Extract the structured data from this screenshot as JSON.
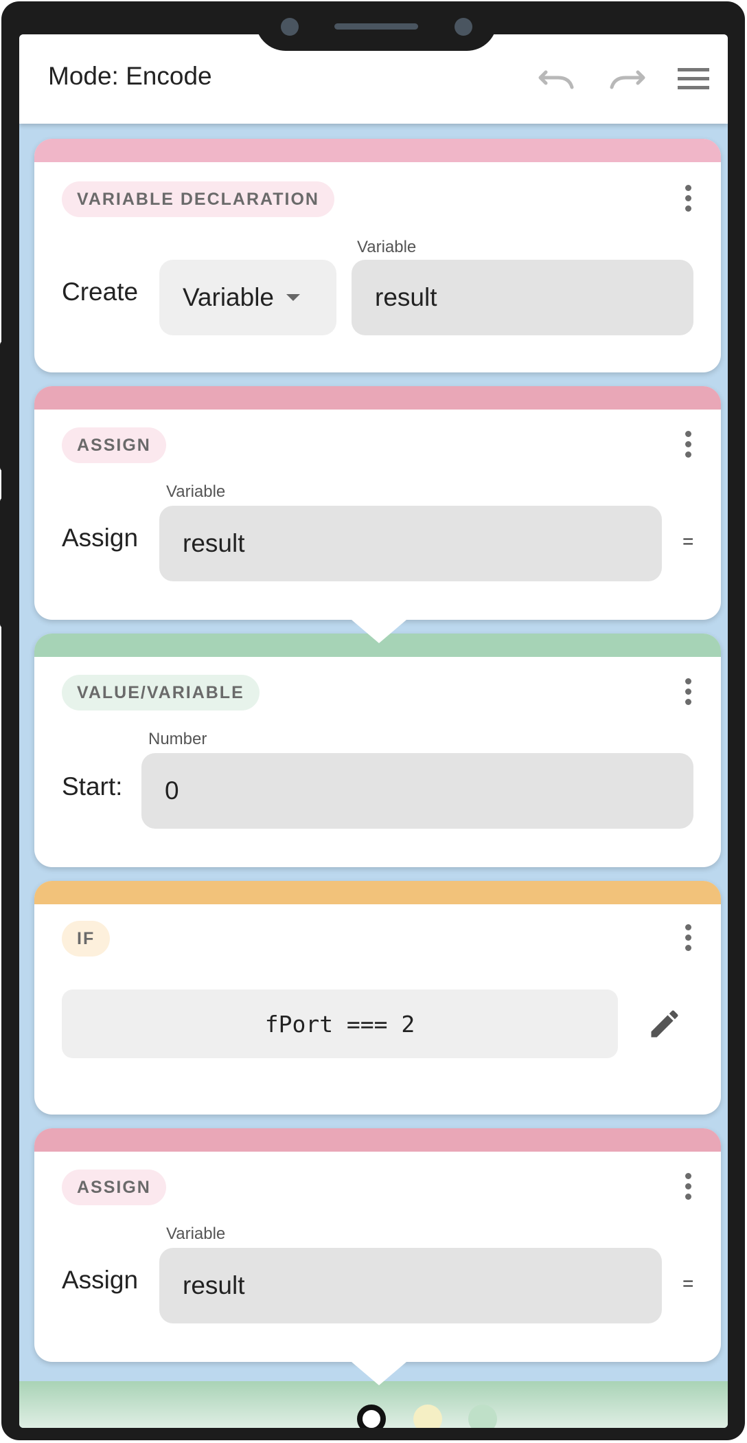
{
  "header": {
    "title": "Mode: Encode"
  },
  "colors": {
    "pink": "#f0b6c8",
    "rose": "#e9a7b7",
    "green": "#a6d3b6",
    "orange": "#f2c27a",
    "badge_pink_bg": "#fbe8ee",
    "badge_green_bg": "#e7f3eb",
    "badge_orange_bg": "#fdf0dc"
  },
  "blocks": [
    {
      "badge": "VARIABLE DECLARATION",
      "label": "Create",
      "select_value": "Variable",
      "field_label": "Variable",
      "field_value": "result"
    },
    {
      "badge": "ASSIGN",
      "label": "Assign",
      "field_label": "Variable",
      "field_value": "result",
      "suffix": "="
    },
    {
      "badge": "VALUE/VARIABLE",
      "label": "Start:",
      "field_label": "Number",
      "field_value": "0"
    },
    {
      "badge": "IF",
      "condition": "fPort === 2"
    },
    {
      "badge": "ASSIGN",
      "label": "Assign",
      "field_label": "Variable",
      "field_value": "result",
      "suffix": "="
    }
  ],
  "icons": [
    "undo-icon",
    "redo-icon",
    "menu-icon",
    "more-vert-icon",
    "edit-pencil-icon",
    "caret-down-icon"
  ],
  "pagination": {
    "active_index": 0,
    "count": 3
  }
}
